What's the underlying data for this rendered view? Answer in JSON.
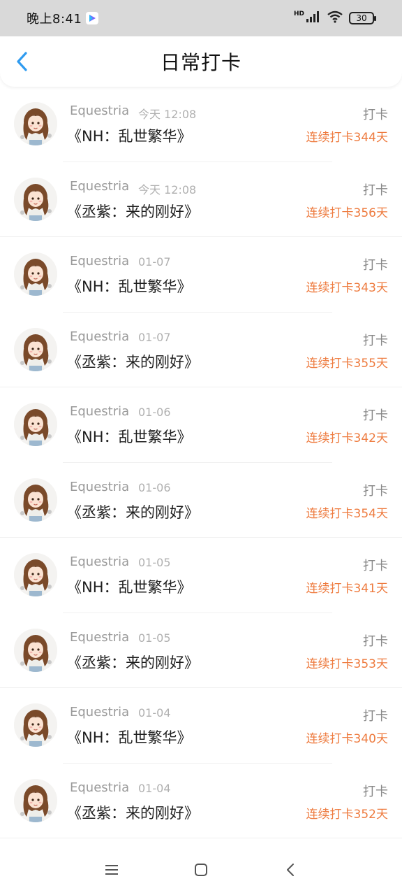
{
  "status_bar": {
    "time": "晚上8:41",
    "network_label": "HD",
    "battery": "30"
  },
  "header": {
    "title": "日常打卡"
  },
  "entries": [
    {
      "author": "Equestria",
      "time": "今天 12:08",
      "title": "《NH：乱世繁华》",
      "action": "打卡",
      "streak": "连续打卡344天"
    },
    {
      "author": "Equestria",
      "time": "今天 12:08",
      "title": "《丞紫：来的刚好》",
      "action": "打卡",
      "streak": "连续打卡356天"
    },
    {
      "author": "Equestria",
      "time": "01-07",
      "title": "《NH：乱世繁华》",
      "action": "打卡",
      "streak": "连续打卡343天"
    },
    {
      "author": "Equestria",
      "time": "01-07",
      "title": "《丞紫：来的刚好》",
      "action": "打卡",
      "streak": "连续打卡355天"
    },
    {
      "author": "Equestria",
      "time": "01-06",
      "title": "《NH：乱世繁华》",
      "action": "打卡",
      "streak": "连续打卡342天"
    },
    {
      "author": "Equestria",
      "time": "01-06",
      "title": "《丞紫：来的刚好》",
      "action": "打卡",
      "streak": "连续打卡354天"
    },
    {
      "author": "Equestria",
      "time": "01-05",
      "title": "《NH：乱世繁华》",
      "action": "打卡",
      "streak": "连续打卡341天"
    },
    {
      "author": "Equestria",
      "time": "01-05",
      "title": "《丞紫：来的刚好》",
      "action": "打卡",
      "streak": "连续打卡353天"
    },
    {
      "author": "Equestria",
      "time": "01-04",
      "title": "《NH：乱世繁华》",
      "action": "打卡",
      "streak": "连续打卡340天"
    },
    {
      "author": "Equestria",
      "time": "01-04",
      "title": "《丞紫：来的刚好》",
      "action": "打卡",
      "streak": "连续打卡352天"
    }
  ],
  "colors": {
    "accent_blue": "#2f9bf0",
    "streak_orange": "#ee7b3f",
    "status_bar_bg": "#d9d9d9"
  },
  "icons": {
    "back": "chevron-left-icon",
    "nav_menu": "menu-icon",
    "nav_home": "home-square-icon",
    "nav_back": "back-chevron-icon"
  }
}
